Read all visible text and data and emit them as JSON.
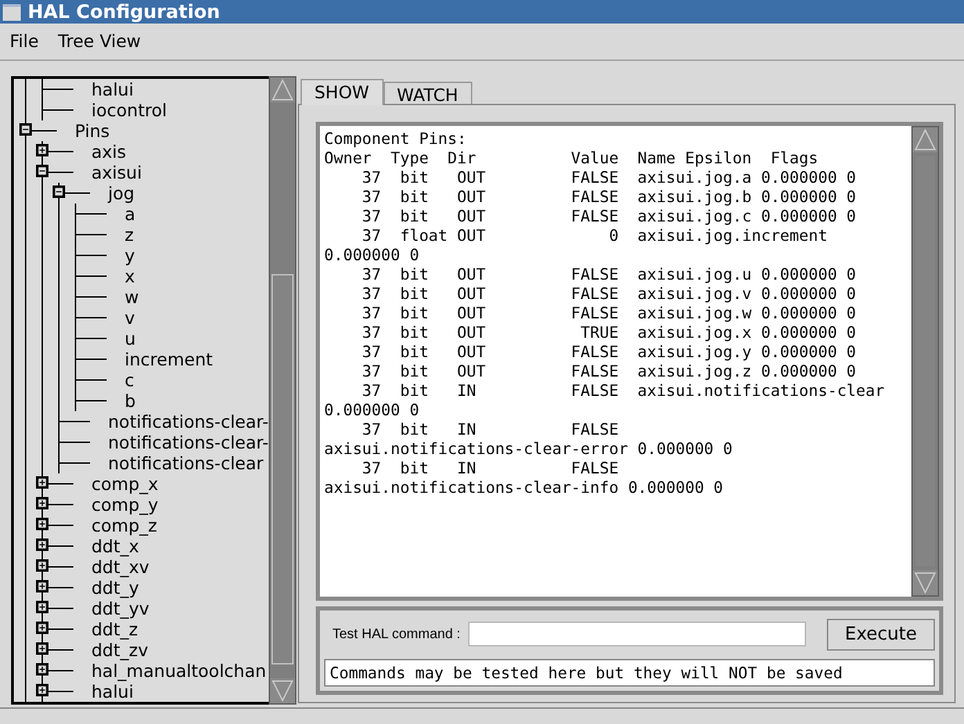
{
  "window": {
    "title": "HAL Configuration"
  },
  "menu": [
    "File",
    "Tree View"
  ],
  "tree": {
    "items": [
      {
        "children": [
          {
            "label": "halui"
          },
          {
            "label": "iocontrol"
          }
        ]
      },
      {
        "label": "Pins",
        "expanded": true,
        "children": [
          {
            "label": "axis",
            "expanded": false
          },
          {
            "label": "axisui",
            "expanded": true,
            "children": [
              {
                "label": "jog",
                "expanded": true,
                "children": [
                  {
                    "label": "a"
                  },
                  {
                    "label": "z"
                  },
                  {
                    "label": "y"
                  },
                  {
                    "label": "x"
                  },
                  {
                    "label": "w"
                  },
                  {
                    "label": "v"
                  },
                  {
                    "label": "u"
                  },
                  {
                    "label": "increment"
                  },
                  {
                    "label": "c"
                  },
                  {
                    "label": "b"
                  }
                ]
              },
              {
                "label": "notifications-clear-"
              },
              {
                "label": "notifications-clear-"
              },
              {
                "label": "notifications-clear"
              }
            ]
          },
          {
            "label": "comp_x",
            "expanded": false
          },
          {
            "label": "comp_y",
            "expanded": false
          },
          {
            "label": "comp_z",
            "expanded": false
          },
          {
            "label": "ddt_x",
            "expanded": false
          },
          {
            "label": "ddt_xv",
            "expanded": false
          },
          {
            "label": "ddt_y",
            "expanded": false
          },
          {
            "label": "ddt_yv",
            "expanded": false
          },
          {
            "label": "ddt_z",
            "expanded": false
          },
          {
            "label": "ddt_zv",
            "expanded": false
          },
          {
            "label": "hal_manualtoolchan",
            "expanded": false
          },
          {
            "label": "halui",
            "expanded": false
          }
        ]
      }
    ]
  },
  "tabs": [
    {
      "label": "SHOW",
      "selected": true
    },
    {
      "label": "WATCH",
      "selected": false
    }
  ],
  "output_lines": [
    "Component Pins:",
    "Owner  Type  Dir          Value  Name Epsilon  Flags",
    "    37  bit   OUT         FALSE  axisui.jog.a 0.000000 0",
    "    37  bit   OUT         FALSE  axisui.jog.b 0.000000 0",
    "    37  bit   OUT         FALSE  axisui.jog.c 0.000000 0",
    "    37  float OUT             0  axisui.jog.increment",
    "0.000000 0",
    "    37  bit   OUT         FALSE  axisui.jog.u 0.000000 0",
    "    37  bit   OUT         FALSE  axisui.jog.v 0.000000 0",
    "    37  bit   OUT         FALSE  axisui.jog.w 0.000000 0",
    "    37  bit   OUT          TRUE  axisui.jog.x 0.000000 0",
    "    37  bit   OUT         FALSE  axisui.jog.y 0.000000 0",
    "    37  bit   OUT         FALSE  axisui.jog.z 0.000000 0",
    "    37  bit   IN          FALSE  axisui.notifications-clear",
    "0.000000 0",
    "    37  bit   IN          FALSE",
    "axisui.notifications-clear-error 0.000000 0",
    "    37  bit   IN          FALSE",
    "axisui.notifications-clear-info 0.000000 0"
  ],
  "command": {
    "label": "Test HAL command :",
    "button": "Execute",
    "message": "Commands may be tested here but they will NOT be saved"
  }
}
